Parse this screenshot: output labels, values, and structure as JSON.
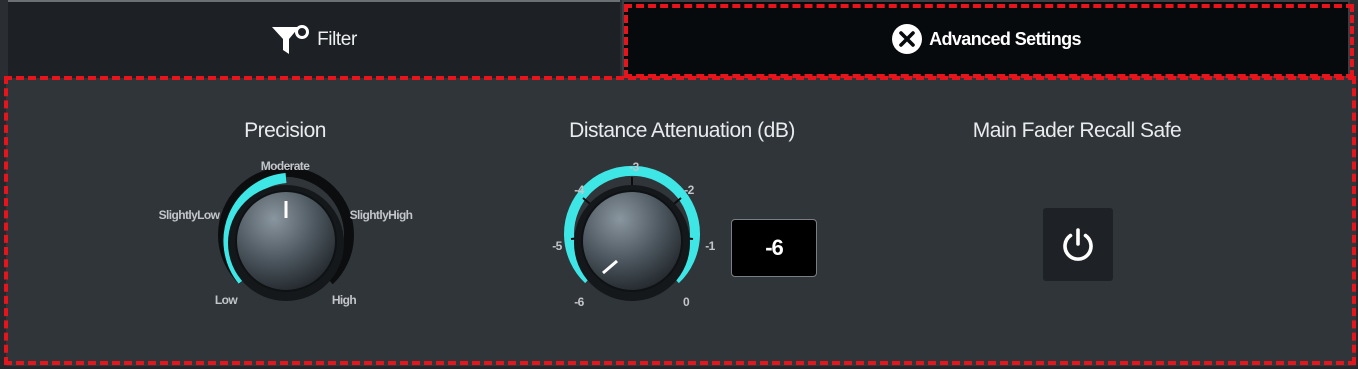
{
  "tabs": {
    "filter": {
      "label": "Filter",
      "icon": "filter-icon"
    },
    "advanced": {
      "label": "Advanced Settings",
      "icon": "close-circle-icon",
      "active": true
    }
  },
  "precision": {
    "title": "Precision",
    "labels": {
      "low": "Low",
      "slightly_low": "SlightlyLow",
      "moderate": "Moderate",
      "slightly_high": "SlightlyHigh",
      "high": "High"
    },
    "selected": "Moderate"
  },
  "distance_attenuation": {
    "title": "Distance Attenuation (dB)",
    "scale": [
      "-6",
      "-5",
      "-4",
      "-3",
      "-2",
      "-1",
      "0"
    ],
    "value": "-6"
  },
  "recall_safe": {
    "title": "Main Fader Recall Safe",
    "icon": "power-icon"
  },
  "colors": {
    "accent": "#3ee6e6",
    "annotation_outline": "#e8141c",
    "panel": "#30353a"
  }
}
